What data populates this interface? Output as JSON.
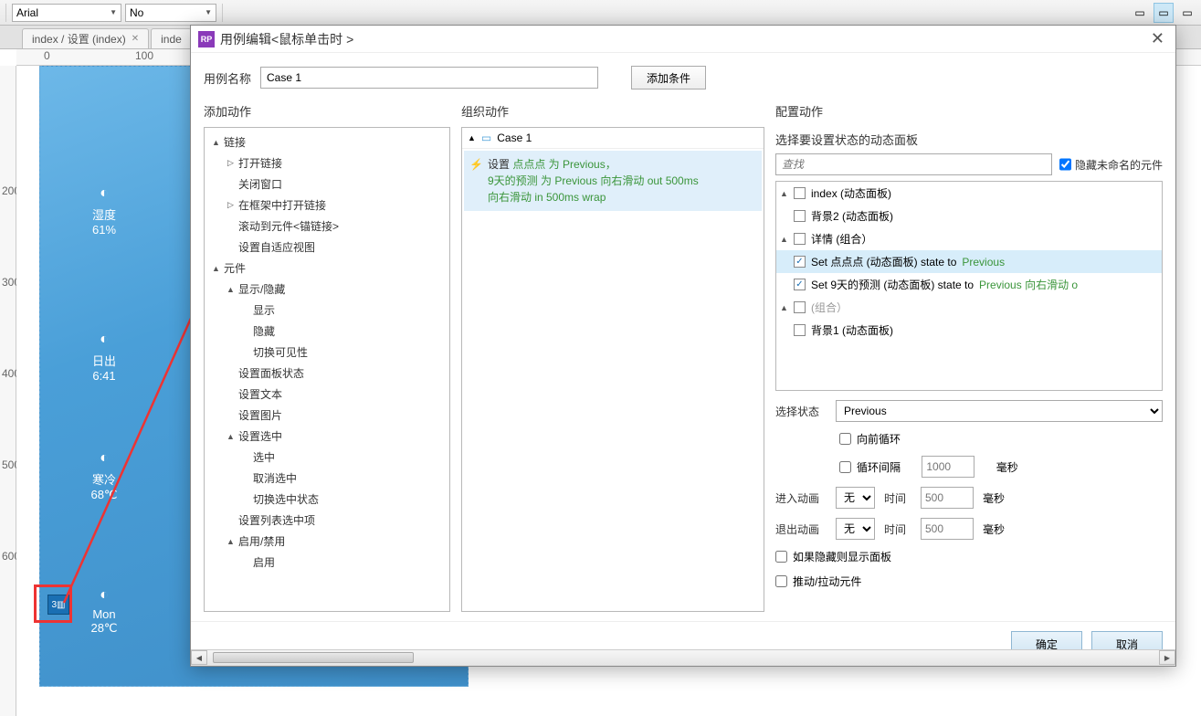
{
  "toolbar": {
    "font": "Arial",
    "style": "No"
  },
  "tabs": [
    {
      "label": "index / 设置 (index)"
    },
    {
      "label": "inde"
    }
  ],
  "ruler": {
    "h": [
      "0",
      "100"
    ],
    "v": [
      "200",
      "300",
      "400",
      "500",
      "600"
    ]
  },
  "phone_cards": [
    {
      "lbl": "湿度",
      "val": "61%"
    },
    {
      "lbl": "日出",
      "val": "6:41"
    },
    {
      "lbl": "寒冷",
      "val": "68℃"
    },
    {
      "lbl": "Mon",
      "val": "28℃"
    }
  ],
  "dialog": {
    "title": "用例编辑<鼠标单击时 >",
    "case_name_label": "用例名称",
    "case_name_value": "Case 1",
    "add_condition": "添加条件",
    "col1_title": "添加动作",
    "col2_title": "组织动作",
    "col3_title": "配置动作",
    "ok": "确定",
    "cancel": "取消"
  },
  "actions_tree": [
    {
      "t": "链接",
      "tw": "▲",
      "ind": 0
    },
    {
      "t": "打开链接",
      "tw": "▷",
      "ind": 1
    },
    {
      "t": "关闭窗口",
      "tw": "",
      "ind": 1
    },
    {
      "t": "在框架中打开链接",
      "tw": "▷",
      "ind": 1
    },
    {
      "t": "滚动到元件<锚链接>",
      "tw": "",
      "ind": 1
    },
    {
      "t": "设置自适应视图",
      "tw": "",
      "ind": 1
    },
    {
      "t": "元件",
      "tw": "▲",
      "ind": 0
    },
    {
      "t": "显示/隐藏",
      "tw": "▲",
      "ind": 1
    },
    {
      "t": "显示",
      "tw": "",
      "ind": 2
    },
    {
      "t": "隐藏",
      "tw": "",
      "ind": 2
    },
    {
      "t": "切换可见性",
      "tw": "",
      "ind": 2
    },
    {
      "t": "设置面板状态",
      "tw": "",
      "ind": 1
    },
    {
      "t": "设置文本",
      "tw": "",
      "ind": 1
    },
    {
      "t": "设置图片",
      "tw": "",
      "ind": 1
    },
    {
      "t": "设置选中",
      "tw": "▲",
      "ind": 1
    },
    {
      "t": "选中",
      "tw": "",
      "ind": 2
    },
    {
      "t": "取消选中",
      "tw": "",
      "ind": 2
    },
    {
      "t": "切换选中状态",
      "tw": "",
      "ind": 2
    },
    {
      "t": "设置列表选中项",
      "tw": "",
      "ind": 1
    },
    {
      "t": "启用/禁用",
      "tw": "▲",
      "ind": 1
    },
    {
      "t": "启用",
      "tw": "",
      "ind": 2
    }
  ],
  "org": {
    "case": "Case 1",
    "action_text": {
      "p1_a": "设置 ",
      "p1_b": "点点点 为 Previous，",
      "p2": "9天的预测 为 Previous 向右滑动 out 500ms",
      "p3": "向右滑动 in 500ms wrap"
    }
  },
  "cfg": {
    "sub1": "选择要设置状态的动态面板",
    "search_ph": "查找",
    "hide_unnamed": "隐藏未命名的元件",
    "tree": [
      {
        "tw": "▲",
        "cb": "",
        "txt": "index (动态面板)",
        "ind": 0
      },
      {
        "tw": "",
        "cb": "",
        "txt": "背景2 (动态面板)",
        "ind": 1
      },
      {
        "tw": "▲",
        "cb": "",
        "txt": "详情 (组合）",
        "ind": 1
      },
      {
        "tw": "",
        "cb": "on",
        "txt": "Set 点点点 (动态面板) state to ",
        "after": "Previous",
        "ind": 2,
        "sel": true
      },
      {
        "tw": "",
        "cb": "on",
        "txt": "Set 9天的预测 (动态面板) state to ",
        "after": "Previous 向右滑动 o",
        "ind": 2
      },
      {
        "tw": "▲",
        "cb": "",
        "txt": "(组合）",
        "ind": 1,
        "gray": true
      },
      {
        "tw": "",
        "cb": "",
        "txt": "背景1 (动态面板)",
        "ind": 2
      }
    ],
    "state_label": "选择状态",
    "state_value": "Previous",
    "loop_forward": "向前循环",
    "loop_interval": "循环间隔",
    "interval_val": "1000",
    "ms": "毫秒",
    "anim_in": "进入动画",
    "anim_out": "退出动画",
    "anim_none": "无",
    "time": "时间",
    "time_val": "500",
    "show_if_hidden": "如果隐藏则显示面板",
    "push_pull": "推动/拉动元件"
  }
}
